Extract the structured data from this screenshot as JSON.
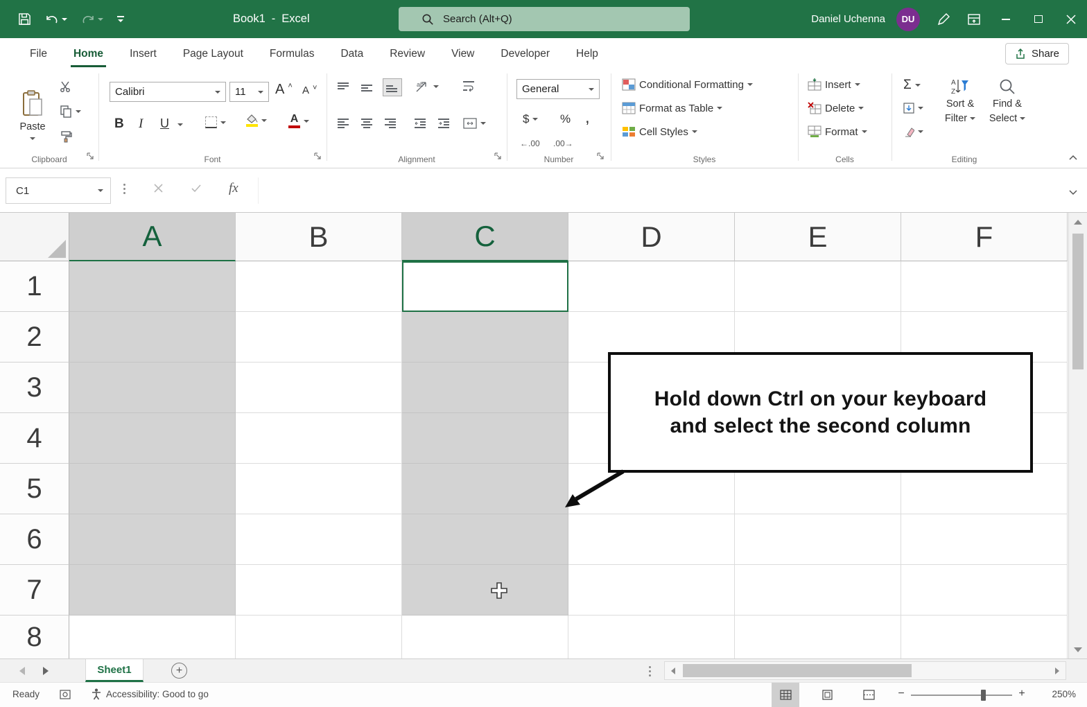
{
  "colors": {
    "accent_green": "#217346",
    "titlebar_green": "#217346",
    "selection_gray": "#d3d3d3",
    "avatar_purple": "#7b2e8f",
    "fill_swatch_yellow": "#ffe400",
    "font_color_swatch_red": "#c00000"
  },
  "title_bar": {
    "workbook_name": "Book1",
    "title_separator": "-",
    "app_name": "Excel",
    "search_placeholder": "Search (Alt+Q)",
    "user_name": "Daniel Uchenna",
    "user_initials": "DU"
  },
  "menu": {
    "tabs": [
      {
        "label": "File"
      },
      {
        "label": "Home"
      },
      {
        "label": "Insert"
      },
      {
        "label": "Page Layout"
      },
      {
        "label": "Formulas"
      },
      {
        "label": "Data"
      },
      {
        "label": "Review"
      },
      {
        "label": "View"
      },
      {
        "label": "Developer"
      },
      {
        "label": "Help"
      }
    ],
    "share_label": "Share"
  },
  "ribbon": {
    "clipboard": {
      "group_label": "Clipboard",
      "paste_label": "Paste"
    },
    "font": {
      "group_label": "Font",
      "font_name": "Calibri",
      "font_size": "11"
    },
    "alignment": {
      "group_label": "Alignment"
    },
    "number": {
      "group_label": "Number",
      "format_value": "General"
    },
    "styles": {
      "group_label": "Styles",
      "conditional_formatting": "Conditional Formatting",
      "format_as_table": "Format as Table",
      "cell_styles": "Cell Styles"
    },
    "cells": {
      "group_label": "Cells",
      "insert": "Insert",
      "delete": "Delete",
      "format": "Format"
    },
    "editing": {
      "group_label": "Editing",
      "sort_filter_line1": "Sort &",
      "sort_filter_line2": "Filter",
      "find_select_line1": "Find &",
      "find_select_line2": "Select"
    }
  },
  "glyphs": {
    "bold": "B",
    "italic": "I",
    "underline": "U",
    "grow_font": "A",
    "shrink_font": "A",
    "dollar": "$",
    "percent": "%",
    "comma": ",",
    "increase_decimal": "←.00",
    "decrease_decimal": ".00→",
    "sigma": "Σ",
    "fx": "fx",
    "font_color_letter": "A",
    "orientation": "ab",
    "minus": "−",
    "plus": "+"
  },
  "formula_bar": {
    "name_box_value": "C1",
    "formula_value": ""
  },
  "grid": {
    "column_headers": [
      "A",
      "B",
      "C",
      "D",
      "E",
      "F"
    ],
    "row_headers": [
      "1",
      "2",
      "3",
      "4",
      "5",
      "6",
      "7",
      "8"
    ],
    "selected_columns": [
      "A",
      "C"
    ],
    "selected_rows_visible": 7,
    "active_cell": "C1"
  },
  "callout": {
    "line1": "Hold down Ctrl on your keyboard",
    "line2": "and select the second column"
  },
  "sheet_bar": {
    "sheet_tab": "Sheet1"
  },
  "status_bar": {
    "ready": "Ready",
    "accessibility": "Accessibility: Good to go",
    "zoom_value": "250%"
  }
}
